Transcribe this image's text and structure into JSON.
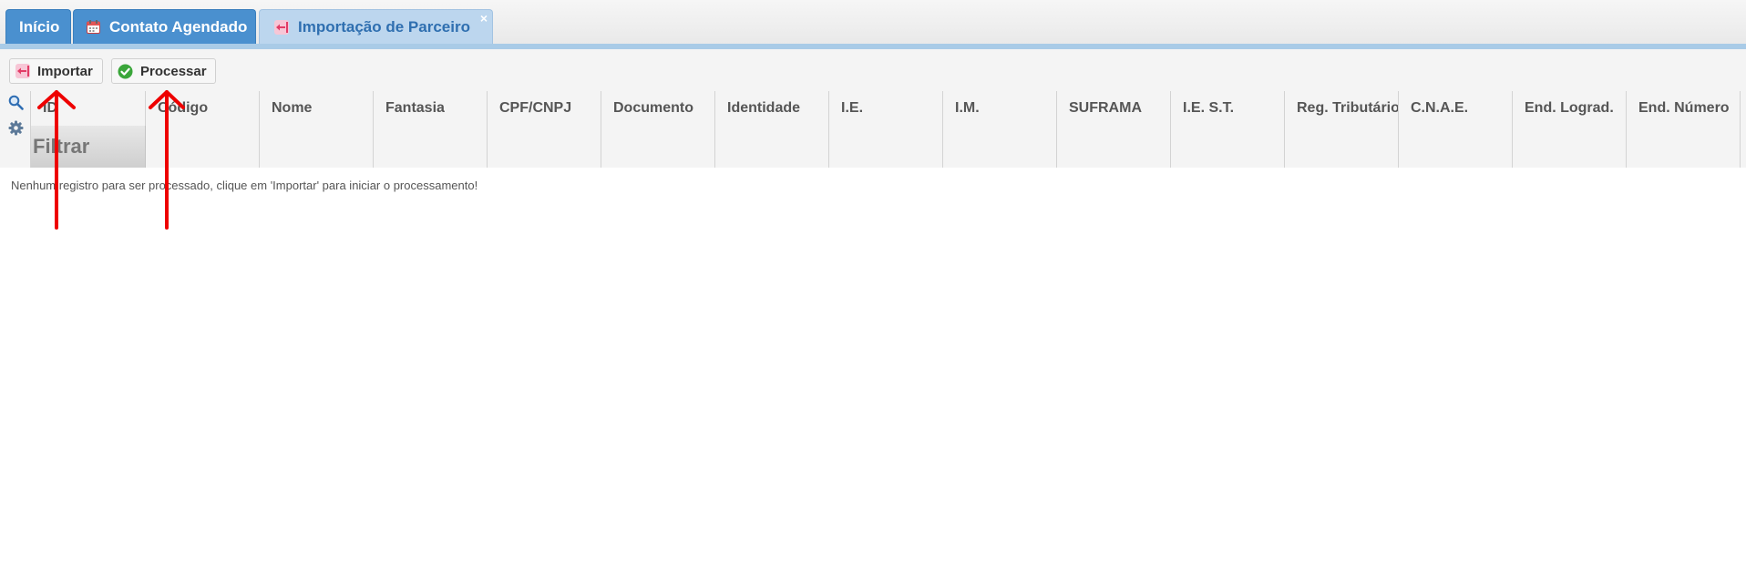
{
  "tabs": [
    {
      "label": "Início",
      "state": "inactive"
    },
    {
      "label": "Contato Agendado",
      "state": "inactive",
      "icon": "calendar-icon"
    },
    {
      "label": "Importação de Parceiro",
      "state": "active",
      "icon": "import-arrow-icon",
      "close": "×"
    }
  ],
  "toolbar": {
    "import_label": "Importar",
    "process_label": "Processar"
  },
  "grid": {
    "columns": [
      "ID",
      "Código",
      "Nome",
      "Fantasia",
      "CPF/CNPJ",
      "Documento",
      "Identidade",
      "I.E.",
      "I.M.",
      "SUFRAMA",
      "I.E. S.T.",
      "Reg. Tributário",
      "C.N.A.E.",
      "End. Lograd.",
      "End. Número"
    ],
    "filter_label": "Filtrar",
    "empty_message": "Nenhum registro para ser processado, clique em 'Importar' para iniciar o processamento!"
  },
  "colors": {
    "tab_blue": "#4a90cf",
    "tab_active_bg": "#bcd6ee",
    "tab_active_text": "#2f6fb0",
    "annotation_red": "#ee0000",
    "success_green": "#3aa63a"
  }
}
